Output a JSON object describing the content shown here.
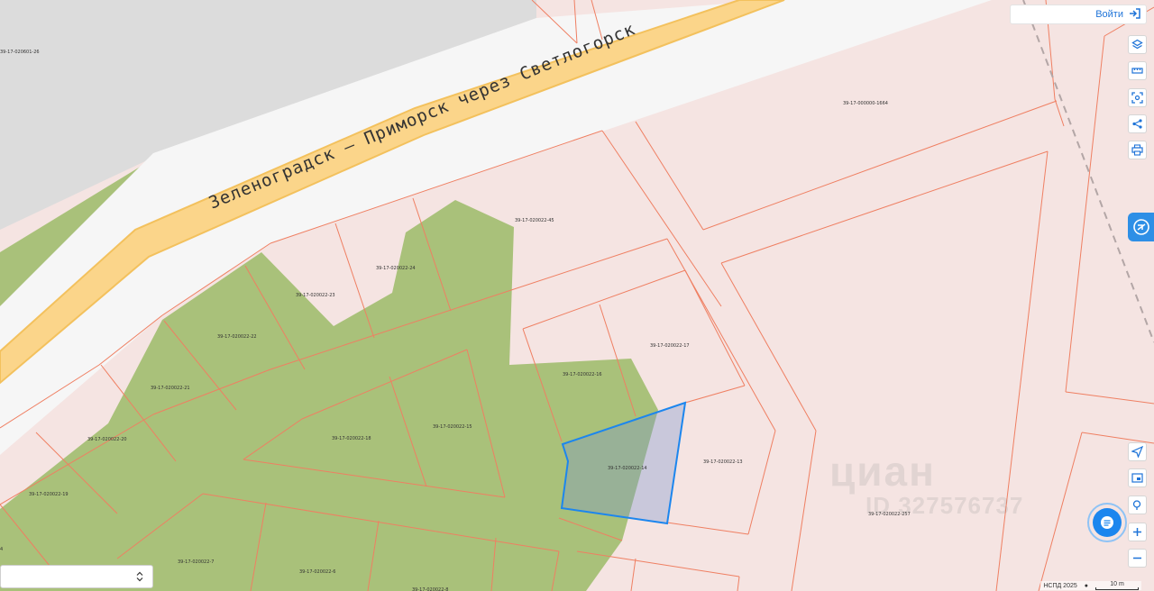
{
  "road": {
    "name": "Зеленоградск – Приморск через Светлогорск"
  },
  "parcels": [
    {
      "id": "39-17-020601-26"
    },
    {
      "id": "39-17-000000-1664"
    },
    {
      "id": "39-17-020022-45"
    },
    {
      "id": "39-17-020022-24"
    },
    {
      "id": "39-17-020022-23"
    },
    {
      "id": "39-17-020022-22"
    },
    {
      "id": "39-17-020022-21"
    },
    {
      "id": "39-17-020022-20"
    },
    {
      "id": "39-17-020022-19"
    },
    {
      "id": "39-17-020022-18"
    },
    {
      "id": "39-17-020022-17"
    },
    {
      "id": "39-17-020022-16"
    },
    {
      "id": "39-17-020022-15"
    },
    {
      "id": "39-17-020022-14"
    },
    {
      "id": "39-17-020022-13"
    },
    {
      "id": "39-17-020022-257"
    },
    {
      "id": "39-17-020022-7"
    },
    {
      "id": "39-17-020022-6"
    },
    {
      "id": "39-17-020022-8"
    },
    {
      "id": "4"
    }
  ],
  "header": {
    "login_label": "Войти"
  },
  "footer": {
    "attribution": "НСПД 2025",
    "scale_label": "10 m"
  },
  "watermark": {
    "brand": "циан",
    "id": "ID 327576737"
  },
  "colors": {
    "parcel_fill": "#f5e4e2",
    "parcel_border": "#ef7f62",
    "forest": "#a9c17a",
    "road": "#fbd58a",
    "selected": "#1c86ee"
  },
  "toolbar": {
    "icons": [
      "layers-icon",
      "ruler-icon",
      "screenshot-icon",
      "share-icon",
      "print-icon"
    ]
  },
  "map_controls": {
    "icons": [
      "locate-icon",
      "minimap-icon",
      "geo-search-icon",
      "zoom-in-icon",
      "zoom-out-icon"
    ]
  }
}
